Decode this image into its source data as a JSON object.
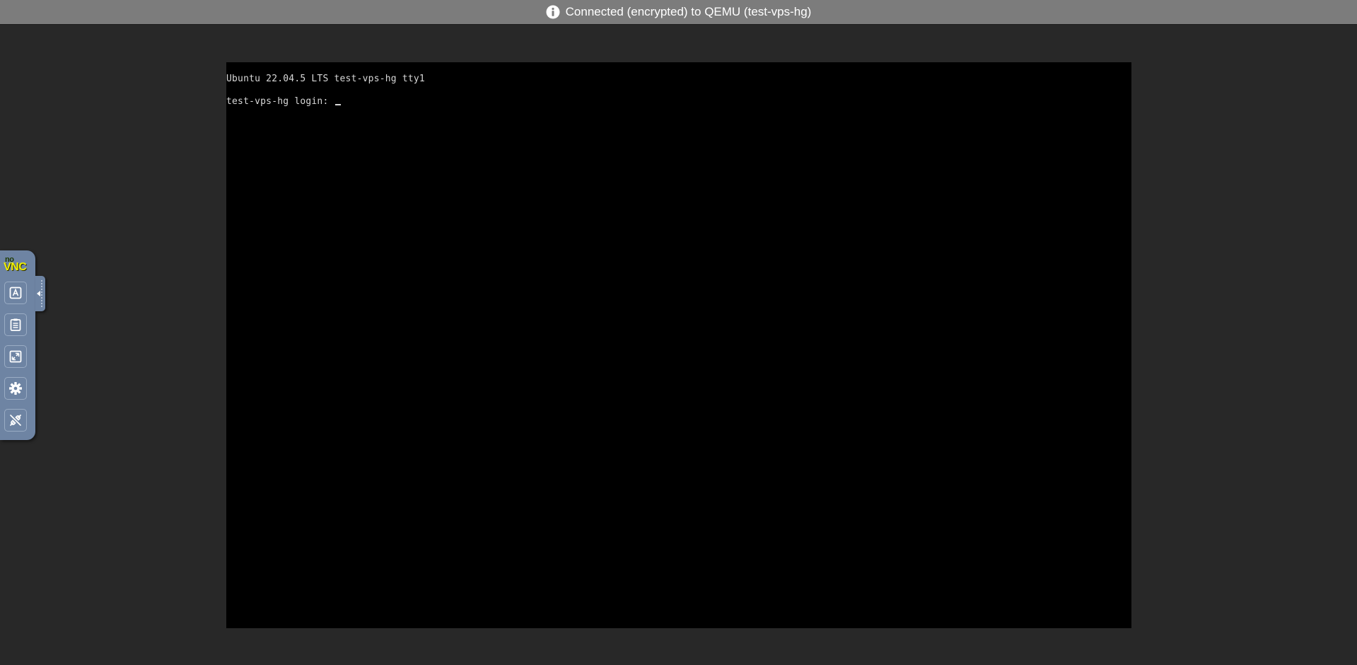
{
  "status": {
    "message": "Connected (encrypted) to QEMU (test-vps-hg)",
    "icon": "info-icon"
  },
  "terminal": {
    "line1": "Ubuntu 22.04.5 LTS test-vps-hg tty1",
    "line2": "test-vps-hg login: "
  },
  "control_bar": {
    "logo": "noVNC",
    "buttons": [
      {
        "icon": "keyboard-icon"
      },
      {
        "icon": "clipboard-icon"
      },
      {
        "icon": "fullscreen-icon"
      },
      {
        "icon": "settings-gear-icon"
      },
      {
        "icon": "disconnect-icon"
      }
    ]
  }
}
